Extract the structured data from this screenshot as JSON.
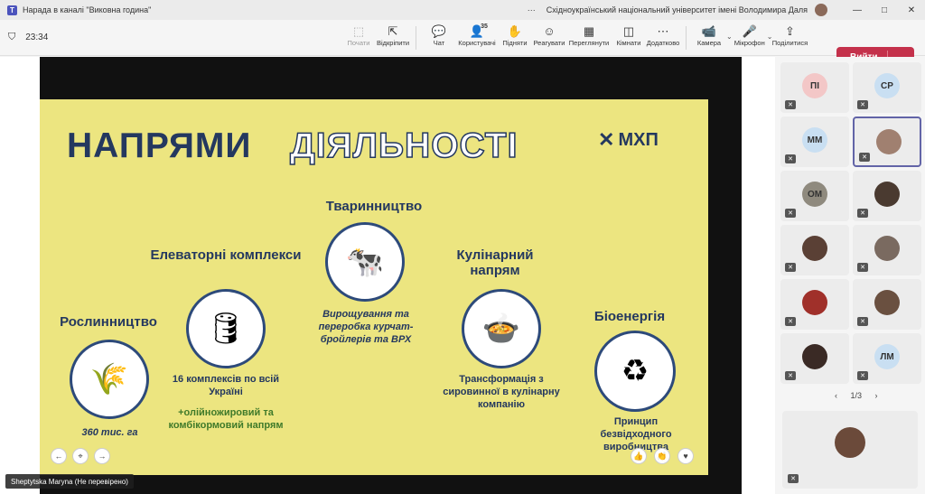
{
  "window": {
    "title": "Нарада в каналі \"Виковна година\"",
    "org": "Східноукраїнський національний університет імені Володимира Даля",
    "menu_icon": "⋯",
    "controls": [
      "—",
      "□",
      "✕"
    ]
  },
  "toolbar": {
    "timer": "23:34",
    "items": [
      {
        "label": "Почати",
        "icon": "⬚",
        "disabled": true
      },
      {
        "label": "Відкріпити",
        "icon": "⇱",
        "disabled": false
      },
      {
        "label": "Чат",
        "icon": "💬",
        "disabled": false
      },
      {
        "label": "Користувачі",
        "icon": "👤",
        "count": "35",
        "disabled": false
      },
      {
        "label": "Підняти",
        "icon": "✋",
        "disabled": false
      },
      {
        "label": "Реагувати",
        "icon": "☺",
        "disabled": false
      },
      {
        "label": "Переглянути",
        "icon": "▦",
        "disabled": false
      },
      {
        "label": "Кімнати",
        "icon": "◫",
        "disabled": false
      },
      {
        "label": "Додатково",
        "icon": "⋯",
        "disabled": false
      },
      {
        "label": "Камера",
        "icon": "📹",
        "disabled": false
      },
      {
        "label": "Мікрофон",
        "icon": "🎤",
        "disabled": false
      },
      {
        "label": "Поділитися",
        "icon": "⇪",
        "disabled": false
      }
    ],
    "leave_label": "Вийти"
  },
  "slide": {
    "title_part1": "НАПРЯМИ",
    "title_part2": "ДІЯЛЬНОСТІ",
    "logo": "МХП",
    "sections": {
      "crops": {
        "title": "Рослинництво",
        "note": "360 тис. га",
        "icon": "🌾"
      },
      "elevators": {
        "title": "Елеваторні комплекси",
        "note": "16 комплексів по всій Україні",
        "note2": "+олійножировий та комбікормовий напрям",
        "icon": "🛢"
      },
      "livestock": {
        "title": "Тваринництво",
        "note": "Вирощування та переробка курчат-бройлерів та ВРХ",
        "icon": "🐄"
      },
      "culinary": {
        "title": "Кулінарний напрям",
        "note": "Трансформація з сировинної в кулінарну компанію",
        "icon": "🍲"
      },
      "bioenergy": {
        "title": "Біоенергія",
        "note": "Принцип безвідходного виробництва",
        "icon": "♻"
      }
    }
  },
  "presenter": {
    "name": "Sheptytska Maryna (Не перевірено)"
  },
  "roster": {
    "participants": [
      {
        "initials": "ПІ",
        "color": "#f3c7c7",
        "video": false
      },
      {
        "initials": "СР",
        "color": "#c9dff2",
        "video": false
      },
      {
        "initials": "ММ",
        "color": "#c9dff2",
        "video": false
      },
      {
        "initials": "",
        "color": "#a08070",
        "video": true
      },
      {
        "initials": "ОМ",
        "color": "#8f8a7e",
        "video": false
      },
      {
        "initials": "",
        "color": "#4a3a30",
        "video": true
      },
      {
        "initials": "",
        "color": "#5a4035",
        "video": true
      },
      {
        "initials": "",
        "color": "#7a6a60",
        "video": true
      },
      {
        "initials": "",
        "color": "#a0302a",
        "video": true
      },
      {
        "initials": "",
        "color": "#6a5040",
        "video": true
      },
      {
        "initials": "",
        "color": "#3a2a25",
        "video": true
      },
      {
        "initials": "ЛМ",
        "color": "#c9dff2",
        "video": false
      }
    ],
    "pager": "1/3"
  }
}
